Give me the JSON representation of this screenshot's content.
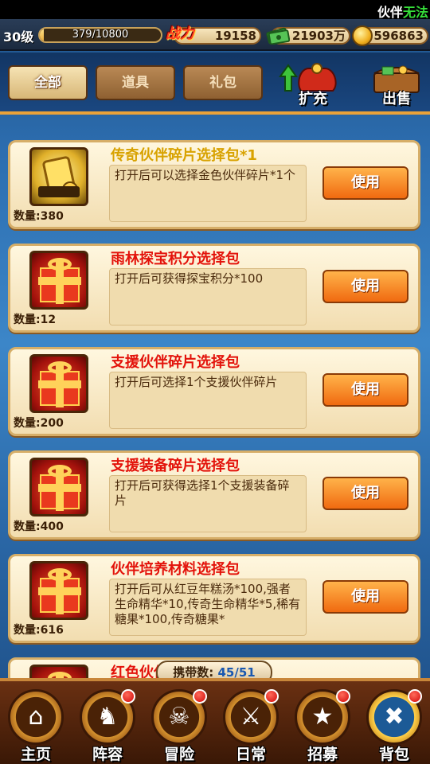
{
  "ticker": {
    "text": "伙伴",
    "highlight": "无法"
  },
  "status": {
    "level": "30级",
    "exp_text": "379/10800",
    "exp_fraction": 0.035,
    "power_label": "战力",
    "power": "19158",
    "cash": "21903万",
    "gold": "596863"
  },
  "tabs": [
    {
      "label": "全部",
      "active": true
    },
    {
      "label": "道具",
      "active": false
    },
    {
      "label": "礼包",
      "active": false
    }
  ],
  "actions": {
    "expand": "扩充",
    "sell": "出售"
  },
  "items": [
    {
      "title": "传奇伙伴碎片选择包*1",
      "desc": "打开后可以选择金色伙伴碎片*1个",
      "qty": "数量:380",
      "use": "使用",
      "icon": "gold-card-pack-icon"
    },
    {
      "title": "雨林探宝积分选择包",
      "desc": "打开后可获得探宝积分*100",
      "qty": "数量:12",
      "use": "使用",
      "icon": "gift-box-icon"
    },
    {
      "title": "支援伙伴碎片选择包",
      "desc": "打开后可选择1个支援伙伴碎片",
      "qty": "数量:200",
      "use": "使用",
      "icon": "gift-box-icon"
    },
    {
      "title": "支援装备碎片选择包",
      "desc": "打开后可获得选择1个支援装备碎片",
      "qty": "数量:400",
      "use": "使用",
      "icon": "gift-box-icon"
    },
    {
      "title": "伙伴培养材料选择包",
      "desc": "打开后可从红豆年糕汤*100,强者生命精华*10,传奇生命精华*5,稀有糖果*100,传奇糖果*",
      "qty": "数量:616",
      "use": "使用",
      "icon": "gift-box-icon"
    },
    {
      "title": "红色伙伴碎片选择包",
      "desc": "",
      "qty": "",
      "use": "",
      "icon": "gift-box-icon"
    }
  ],
  "carry": {
    "label": "携带数:",
    "value": "45/51"
  },
  "nav": [
    {
      "label": "主页",
      "icon": "home-icon",
      "dot": false,
      "active": false
    },
    {
      "label": "阵容",
      "icon": "lineup-icon",
      "dot": true,
      "active": false
    },
    {
      "label": "冒险",
      "icon": "adventure-skull-icon",
      "dot": true,
      "active": false
    },
    {
      "label": "日常",
      "icon": "daily-swords-icon",
      "dot": true,
      "active": false
    },
    {
      "label": "招募",
      "icon": "recruit-tavern-icon",
      "dot": true,
      "active": false
    },
    {
      "label": "背包",
      "icon": "backpack-icon",
      "dot": true,
      "active": true
    }
  ]
}
